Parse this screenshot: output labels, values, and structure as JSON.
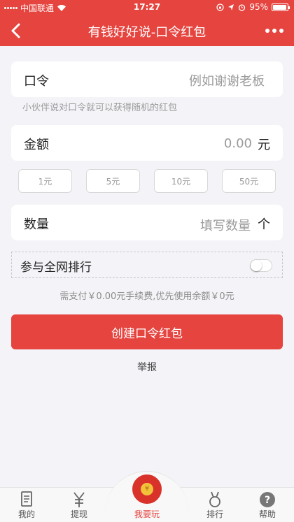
{
  "status_bar": {
    "carrier": "中国联通",
    "time": "17:27",
    "battery": "95%",
    "battery_level": 0.95
  },
  "nav": {
    "title": "有钱好好说-口令红包"
  },
  "form": {
    "password": {
      "label": "口令",
      "placeholder": "例如谢谢老板"
    },
    "hint": "小伙伴说对口令就可以获得随机的红包",
    "amount": {
      "label": "金额",
      "value": "0.00",
      "unit": "元"
    },
    "amount_options": [
      "1元",
      "5元",
      "10元",
      "50元"
    ],
    "quantity": {
      "label": "数量",
      "placeholder": "填写数量",
      "unit": "个"
    },
    "rank": {
      "label": "参与全网排行",
      "enabled": false
    },
    "fee_text": "需支付￥0.00元手续费,优先使用余额￥0元",
    "submit_label": "创建口令红包",
    "report_label": "举报"
  },
  "tabbar": {
    "items": [
      {
        "label": "我的",
        "icon": "receipt-icon"
      },
      {
        "label": "提现",
        "icon": "yen-icon"
      },
      {
        "label": "我要玩",
        "icon": "coin-icon",
        "active": true
      },
      {
        "label": "排行",
        "icon": "medal-icon"
      },
      {
        "label": "帮助",
        "icon": "help-icon"
      }
    ]
  },
  "colors": {
    "accent": "#e5443f",
    "background": "#f4f3f7"
  }
}
